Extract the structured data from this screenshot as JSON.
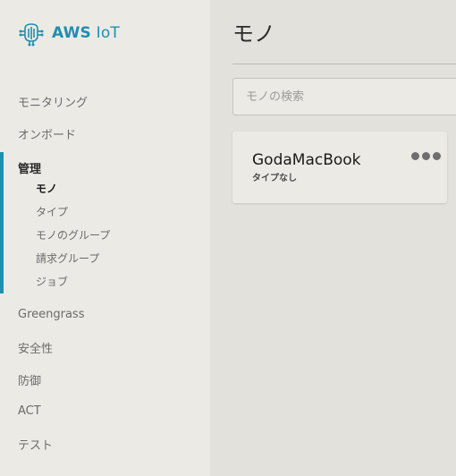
{
  "app": {
    "logo_text_bold": "AWS",
    "logo_text_light": "IoT",
    "accent_color": "#1f8fb0"
  },
  "sidebar": {
    "items": [
      {
        "label": "モニタリング"
      },
      {
        "label": "オンボード"
      }
    ],
    "group": {
      "label": "管理",
      "items": [
        {
          "label": "モノ",
          "active": true
        },
        {
          "label": "タイプ"
        },
        {
          "label": "モノのグループ"
        },
        {
          "label": "請求グループ"
        },
        {
          "label": "ジョブ"
        }
      ]
    },
    "bottom_items": [
      {
        "label": "Greengrass"
      },
      {
        "label": "安全性"
      },
      {
        "label": "防御"
      },
      {
        "label": "ACT"
      },
      {
        "label": "テスト"
      }
    ]
  },
  "main": {
    "title": "モノ",
    "search": {
      "placeholder": "モノの検索",
      "value": ""
    },
    "things": [
      {
        "name": "GodaMacBook",
        "type": "タイプなし",
        "menu_icon": "ellipsis-icon"
      }
    ]
  }
}
